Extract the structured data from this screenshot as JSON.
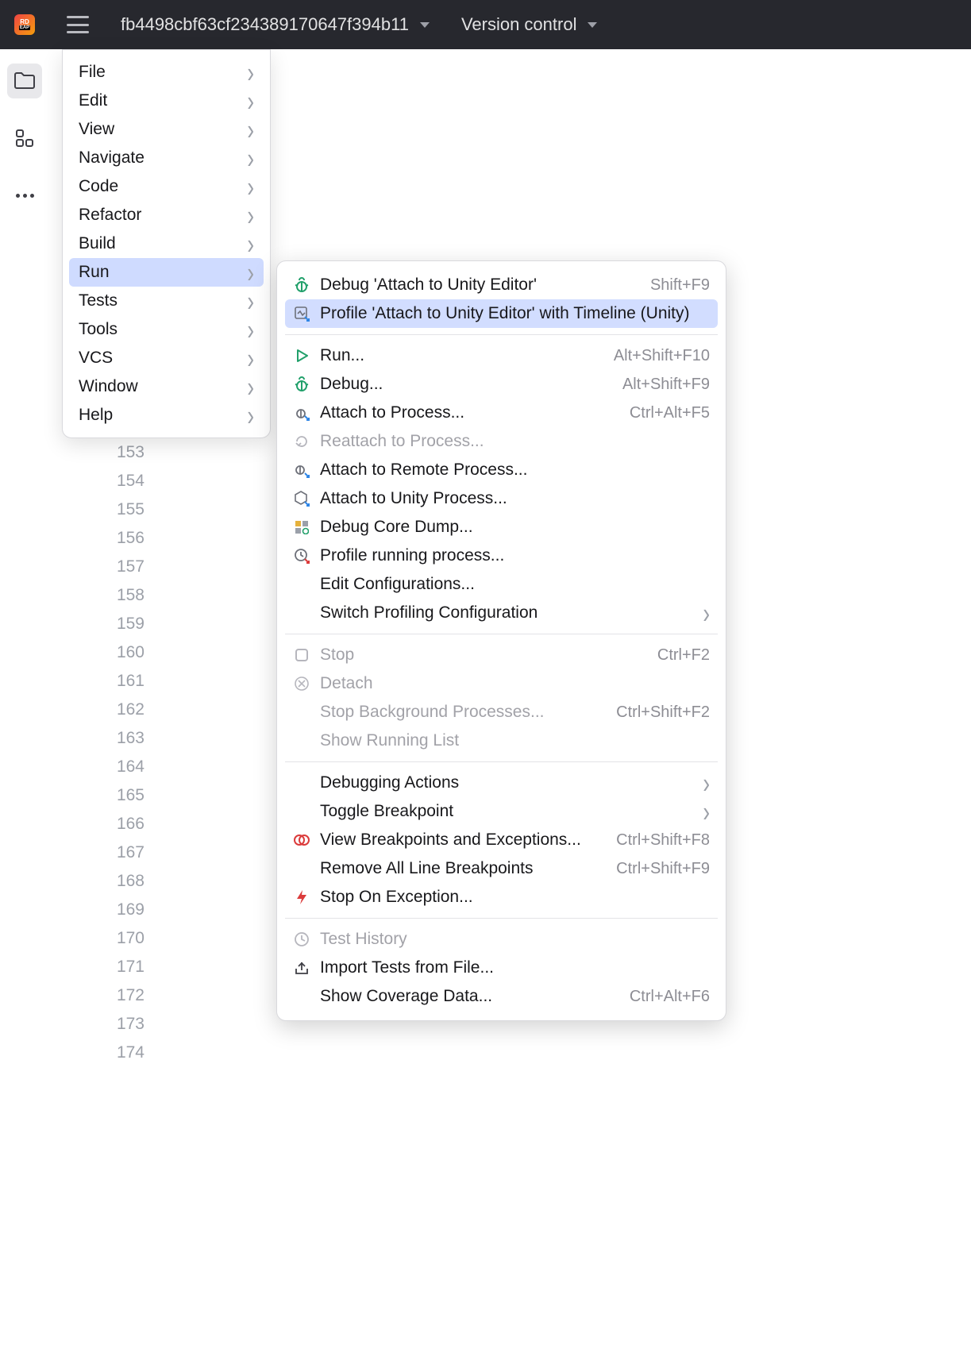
{
  "titlebar": {
    "project_name": "fb4498cbf63cf234389170647f394b11",
    "version_control": "Version control"
  },
  "app_logo": {
    "top": "RD",
    "bottom": "EAP"
  },
  "gutter_lines": [
    "153",
    "154",
    "155",
    "156",
    "157",
    "158",
    "159",
    "160",
    "161",
    "162",
    "163",
    "164",
    "165",
    "166",
    "167",
    "168",
    "169",
    "170",
    "171",
    "172",
    "173",
    "174"
  ],
  "main_menu": [
    {
      "label": "File",
      "selected": false
    },
    {
      "label": "Edit",
      "selected": false
    },
    {
      "label": "View",
      "selected": false
    },
    {
      "label": "Navigate",
      "selected": false
    },
    {
      "label": "Code",
      "selected": false
    },
    {
      "label": "Refactor",
      "selected": false
    },
    {
      "label": "Build",
      "selected": false
    },
    {
      "label": "Run",
      "selected": true
    },
    {
      "label": "Tests",
      "selected": false
    },
    {
      "label": "Tools",
      "selected": false
    },
    {
      "label": "VCS",
      "selected": false
    },
    {
      "label": "Window",
      "selected": false
    },
    {
      "label": "Help",
      "selected": false
    }
  ],
  "run_submenu": {
    "groups": [
      [
        {
          "icon": "bug-green",
          "label": "Debug 'Attach to Unity Editor'",
          "shortcut": "Shift+F9"
        },
        {
          "icon": "profile-unity",
          "label": "Profile 'Attach to Unity Editor' with Timeline (Unity)",
          "highlight": true
        }
      ],
      [
        {
          "icon": "play-green",
          "label": "Run...",
          "shortcut": "Alt+Shift+F10"
        },
        {
          "icon": "bug-green",
          "label": "Debug...",
          "shortcut": "Alt+Shift+F9"
        },
        {
          "icon": "bug-attach",
          "label": "Attach to Process...",
          "shortcut": "Ctrl+Alt+F5"
        },
        {
          "icon": "reattach",
          "label": "Reattach to Process...",
          "disabled": true
        },
        {
          "icon": "bug-remote",
          "label": "Attach to Remote Process..."
        },
        {
          "icon": "unity-attach",
          "label": "Attach to Unity Process..."
        },
        {
          "icon": "core-dump",
          "label": "Debug Core Dump..."
        },
        {
          "icon": "profile-clock",
          "label": "Profile running process..."
        },
        {
          "icon": "",
          "label": "Edit Configurations..."
        },
        {
          "icon": "",
          "label": "Switch Profiling Configuration",
          "submenu": true
        }
      ],
      [
        {
          "icon": "stop",
          "label": "Stop",
          "shortcut": "Ctrl+F2",
          "disabled": true
        },
        {
          "icon": "detach",
          "label": "Detach",
          "disabled": true
        },
        {
          "icon": "",
          "label": "Stop Background Processes...",
          "shortcut": "Ctrl+Shift+F2",
          "disabled": true
        },
        {
          "icon": "",
          "label": "Show Running List",
          "disabled": true
        }
      ],
      [
        {
          "icon": "",
          "label": "Debugging Actions",
          "submenu": true
        },
        {
          "icon": "",
          "label": "Toggle Breakpoint",
          "submenu": true
        },
        {
          "icon": "breakpoints",
          "label": "View Breakpoints and Exceptions...",
          "shortcut": "Ctrl+Shift+F8"
        },
        {
          "icon": "",
          "label": "Remove All Line Breakpoints",
          "shortcut": "Ctrl+Shift+F9"
        },
        {
          "icon": "lightning",
          "label": "Stop On Exception..."
        }
      ],
      [
        {
          "icon": "history",
          "label": "Test History",
          "disabled": true
        },
        {
          "icon": "import",
          "label": "Import Tests from File..."
        },
        {
          "icon": "",
          "label": "Show Coverage Data...",
          "shortcut": "Ctrl+Alt+F6"
        }
      ]
    ]
  }
}
